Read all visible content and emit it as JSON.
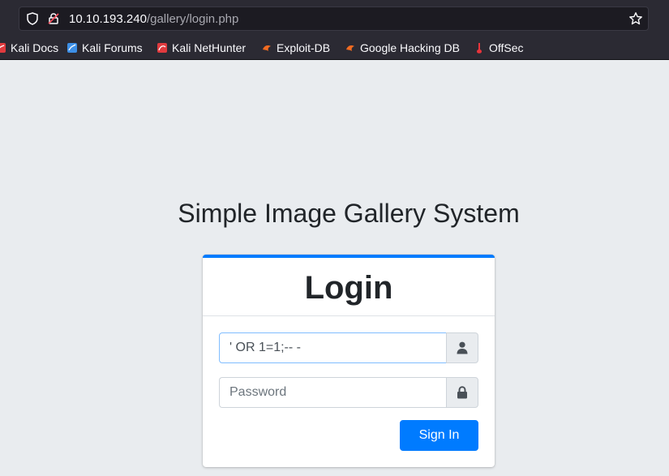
{
  "browser": {
    "url_host": "10.10.193.240",
    "url_path": "/gallery/login.php",
    "bookmarks": [
      {
        "label": "Kali Docs",
        "icon": "kali-docs-icon"
      },
      {
        "label": "Kali Forums",
        "icon": "kali-forums-icon"
      },
      {
        "label": "Kali NetHunter",
        "icon": "kali-nethunter-icon"
      },
      {
        "label": "Exploit-DB",
        "icon": "exploit-db-icon"
      },
      {
        "label": "Google Hacking DB",
        "icon": "ghdb-icon"
      },
      {
        "label": "OffSec",
        "icon": "offsec-icon"
      }
    ]
  },
  "page": {
    "app_title": "Simple Image Gallery System",
    "login_heading": "Login",
    "username_value": "' OR 1=1;-- -",
    "password_placeholder": "Password",
    "signin_label": "Sign In"
  },
  "colors": {
    "accent": "#007bff",
    "page_bg": "#e9ecef",
    "chrome_bg": "#2b2a33"
  }
}
